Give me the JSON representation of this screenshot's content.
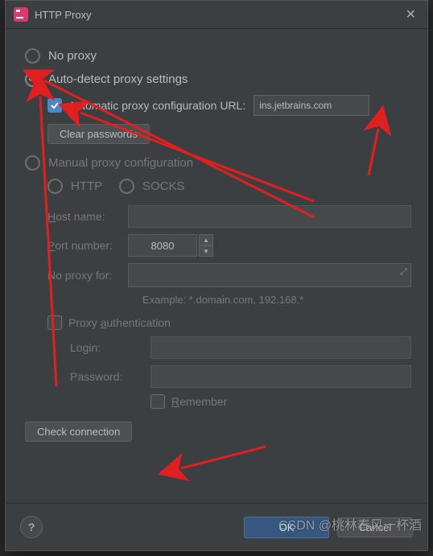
{
  "dialog": {
    "title": "HTTP Proxy"
  },
  "options": {
    "no_proxy": "No proxy",
    "auto_detect": "Auto-detect proxy settings",
    "manual": "Manual proxy configuration"
  },
  "auto": {
    "pac_label": "Automatic proxy configuration URL:",
    "pac_value": "ins.jetbrains.com",
    "clear_pw": "Clear passwords"
  },
  "manual": {
    "http": "HTTP",
    "socks": "SOCKS",
    "host_label": "Host name:",
    "host_value": "",
    "port_label": "Port number:",
    "port_value": "8080",
    "noproxy_label": "No proxy for:",
    "noproxy_value": "",
    "example_hint": "Example: *.domain.com, 192.168.*",
    "auth_label": "Proxy authentication",
    "login_label": "Login:",
    "login_value": "",
    "password_label": "Password:",
    "password_value": "",
    "remember_label": "Remember"
  },
  "actions": {
    "check_connection": "Check connection",
    "ok": "OK",
    "cancel": "Cancel",
    "help": "?"
  },
  "watermark": "CSDN @桃林春风一杯酒"
}
